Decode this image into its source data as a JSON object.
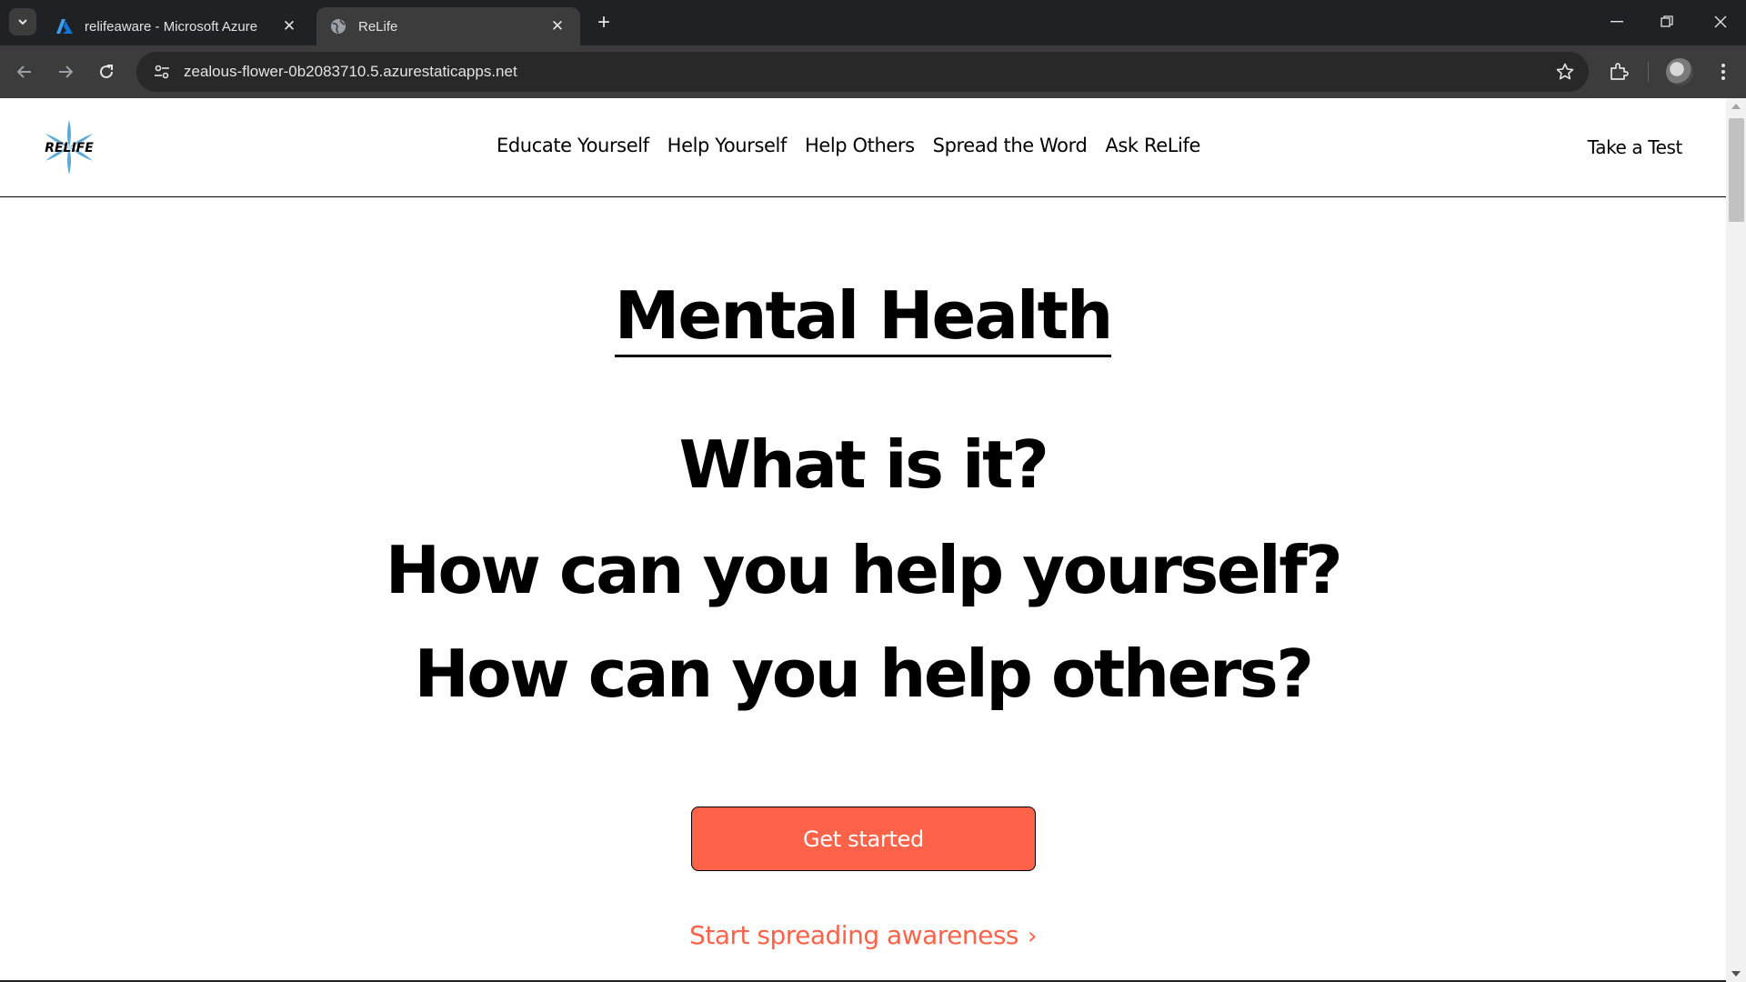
{
  "browser": {
    "tabs": [
      {
        "title": "relifeaware - Microsoft Azure",
        "icon": "azure-icon",
        "active": false
      },
      {
        "title": "ReLife",
        "icon": "globe-icon",
        "active": true
      }
    ],
    "url": "zealous-flower-0b2083710.5.azurestaticapps.net"
  },
  "site": {
    "logo_text": "RELIFE",
    "nav": [
      {
        "label": "Educate Yourself"
      },
      {
        "label": "Help Yourself"
      },
      {
        "label": "Help Others"
      },
      {
        "label": "Spread the Word"
      },
      {
        "label": "Ask ReLife"
      }
    ],
    "take_test": "Take a Test"
  },
  "hero": {
    "title": "Mental Health",
    "line1": "What is it?",
    "line2": "How can you help yourself?",
    "line3": "How can you help others?",
    "cta_label": "Get started",
    "spread_link": "Start spreading awareness"
  },
  "colors": {
    "accent": "#fe6248",
    "chrome_dark": "#202124",
    "chrome_toolbar": "#3c3c3c"
  }
}
